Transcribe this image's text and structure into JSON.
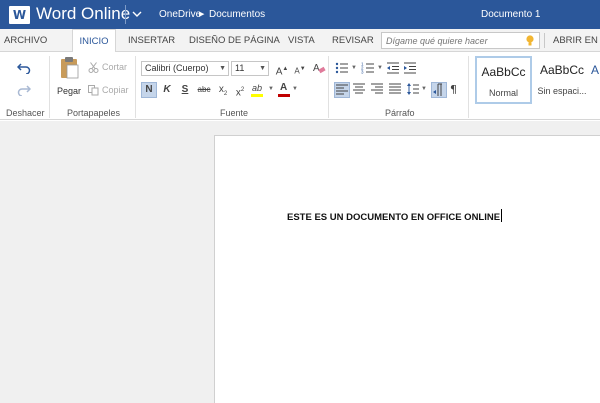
{
  "titlebar": {
    "logo_letter": "W",
    "app_name": "Word Online",
    "breadcrumb": [
      "OneDrive",
      "Documentos"
    ],
    "doc_title": "Documento 1",
    "bg_color": "#2b579a"
  },
  "tabs": [
    {
      "label": "ARCHIVO",
      "active": false
    },
    {
      "label": "INICIO",
      "active": true
    },
    {
      "label": "INSERTAR",
      "active": false
    },
    {
      "label": "DISEÑO DE PÁGINA",
      "active": false
    },
    {
      "label": "VISTA",
      "active": false
    },
    {
      "label": "REVISAR",
      "active": false
    },
    {
      "label": "ABRIR EN W",
      "active": false
    }
  ],
  "tellme": {
    "placeholder": "Dígame qué quiere hacer",
    "icon": "lightbulb-icon"
  },
  "ribbon": {
    "undo": {
      "undo_icon": "undo-icon",
      "redo_icon": "redo-icon",
      "group_label": "Deshacer"
    },
    "clipboard": {
      "paste_label": "Pegar",
      "cut_label": "Cortar",
      "copy_label": "Copiar",
      "group_label": "Portapapeles"
    },
    "font": {
      "font_name": "Calibri (Cuerpo)",
      "font_size": "11",
      "bold": "N",
      "italic": "K",
      "underline": "S",
      "strikethrough": "abc",
      "subscript": "x",
      "subscript_mark": "2",
      "superscript": "x",
      "superscript_mark": "2",
      "grow": "A",
      "shrink": "A",
      "highlight": "ab",
      "font_color": "A",
      "group_label": "Fuente"
    },
    "paragraph": {
      "group_label": "Párrafo"
    },
    "styles": [
      {
        "preview": "AaBbCc",
        "name": "Normal",
        "selected": true
      },
      {
        "preview": "AaBbCc",
        "name": "Sin espaci...",
        "selected": false
      },
      {
        "preview": "A",
        "name": "",
        "selected": false
      }
    ]
  },
  "document": {
    "text": "ESTE ES UN DOCUMENTO EN OFFICE ONLINE"
  },
  "colors": {
    "accent": "#2b579a",
    "highlight": "#ffff00",
    "font_color": "#c00000"
  }
}
